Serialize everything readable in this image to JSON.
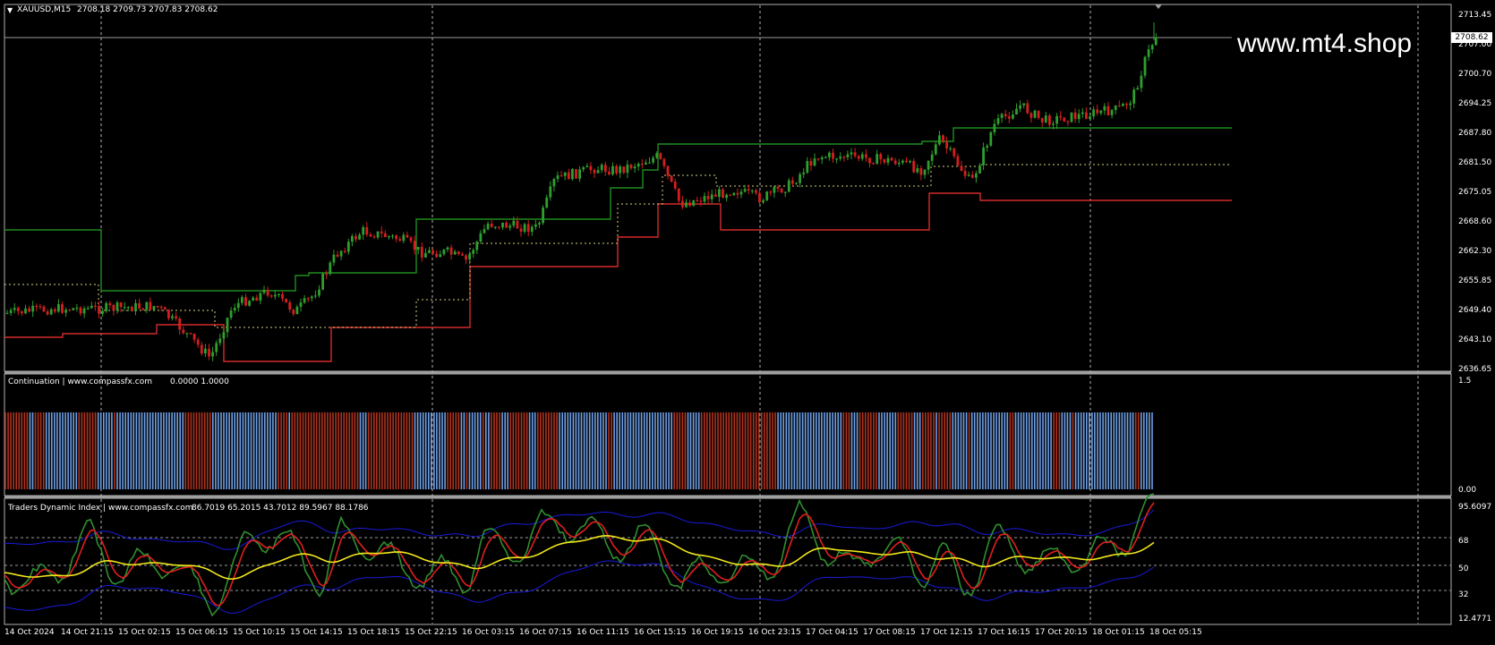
{
  "main_panel": {
    "symbol_title": "XAUUSD,M15",
    "ohlc": "2708.18 2709.73 2707.83 2708.62",
    "current_price": "2708.62",
    "watermark": "www.mt4.shop",
    "price_labels": [
      "2713.45",
      "2707.00",
      "2700.70",
      "2694.25",
      "2687.80",
      "2681.50",
      "2675.05",
      "2668.60",
      "2662.30",
      "2655.85",
      "2649.40",
      "2643.10",
      "2636.65"
    ],
    "colors": {
      "bull": "#2e9e2e",
      "bear": "#d41f1f",
      "green_line": "#1f8c1f",
      "red_line": "#d42a2a",
      "grid": "#b0b0b0"
    }
  },
  "continuation_panel": {
    "title": "Continuation | www.compassfx.com",
    "values": "0.0000 1.0000",
    "scale_top": "1.5",
    "scale_bottom": "0.00",
    "colors": {
      "blue": "#6f9fe6",
      "red": "#b0331f"
    }
  },
  "tdi_panel": {
    "title": "Traders Dynamic Index | www.compassfx.com",
    "values": "86.7019 65.2015 43.7012 89.5967 88.1786",
    "scale_labels": [
      "95.6097",
      "68",
      "50",
      "32",
      "12.4771"
    ],
    "colors": {
      "band": "#1a1adb",
      "signal": "#2f8f2f",
      "fast": "#e01f1f",
      "base": "#f2e61a"
    }
  },
  "time_axis": [
    "14 Oct 2024",
    "14 Oct 21:15",
    "15 Oct 02:15",
    "15 Oct 06:15",
    "15 Oct 10:15",
    "15 Oct 14:15",
    "15 Oct 18:15",
    "15 Oct 22:15",
    "16 Oct 03:15",
    "16 Oct 07:15",
    "16 Oct 11:15",
    "16 Oct 15:15",
    "16 Oct 19:15",
    "16 Oct 23:15",
    "17 Oct 04:15",
    "17 Oct 08:15",
    "17 Oct 12:15",
    "17 Oct 16:15",
    "17 Oct 20:15",
    "18 Oct 01:15",
    "18 Oct 05:15"
  ]
}
